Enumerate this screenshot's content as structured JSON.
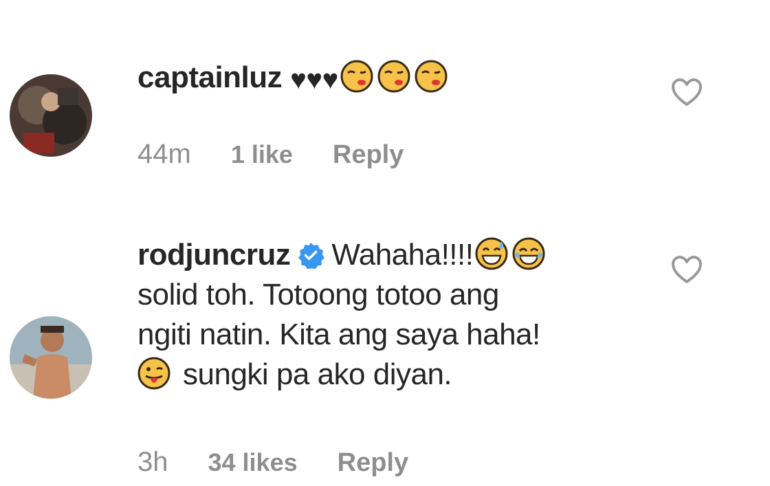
{
  "comments": [
    {
      "username": "captainluz",
      "text": "♥♥♥",
      "emoji_count": 3,
      "time": "44m",
      "likes": "1 like",
      "reply": "Reply"
    },
    {
      "username": "rodjuncruz",
      "verified": true,
      "line1": "Wahaha!!!!",
      "line2": "solid toh. Totoong totoo ang",
      "line3": "ngiti natin. Kita ang saya haha!",
      "line4": "sungki pa ako diyan.",
      "time": "3h",
      "likes": "34 likes",
      "reply": "Reply"
    }
  ],
  "colors": {
    "meta_gray": "#8e8e8e",
    "text": "#262626",
    "verified_blue": "#3897f0",
    "emoji_yellow": "#f6c24a"
  },
  "icons": {
    "like": "heart-outline-icon",
    "verified": "verified-badge-icon",
    "emoji_kiss": "kissing-face-icon",
    "emoji_sweat": "grinning-sweat-face-icon",
    "emoji_joy": "tears-of-joy-face-icon",
    "emoji_tongue": "winking-tongue-face-icon"
  }
}
